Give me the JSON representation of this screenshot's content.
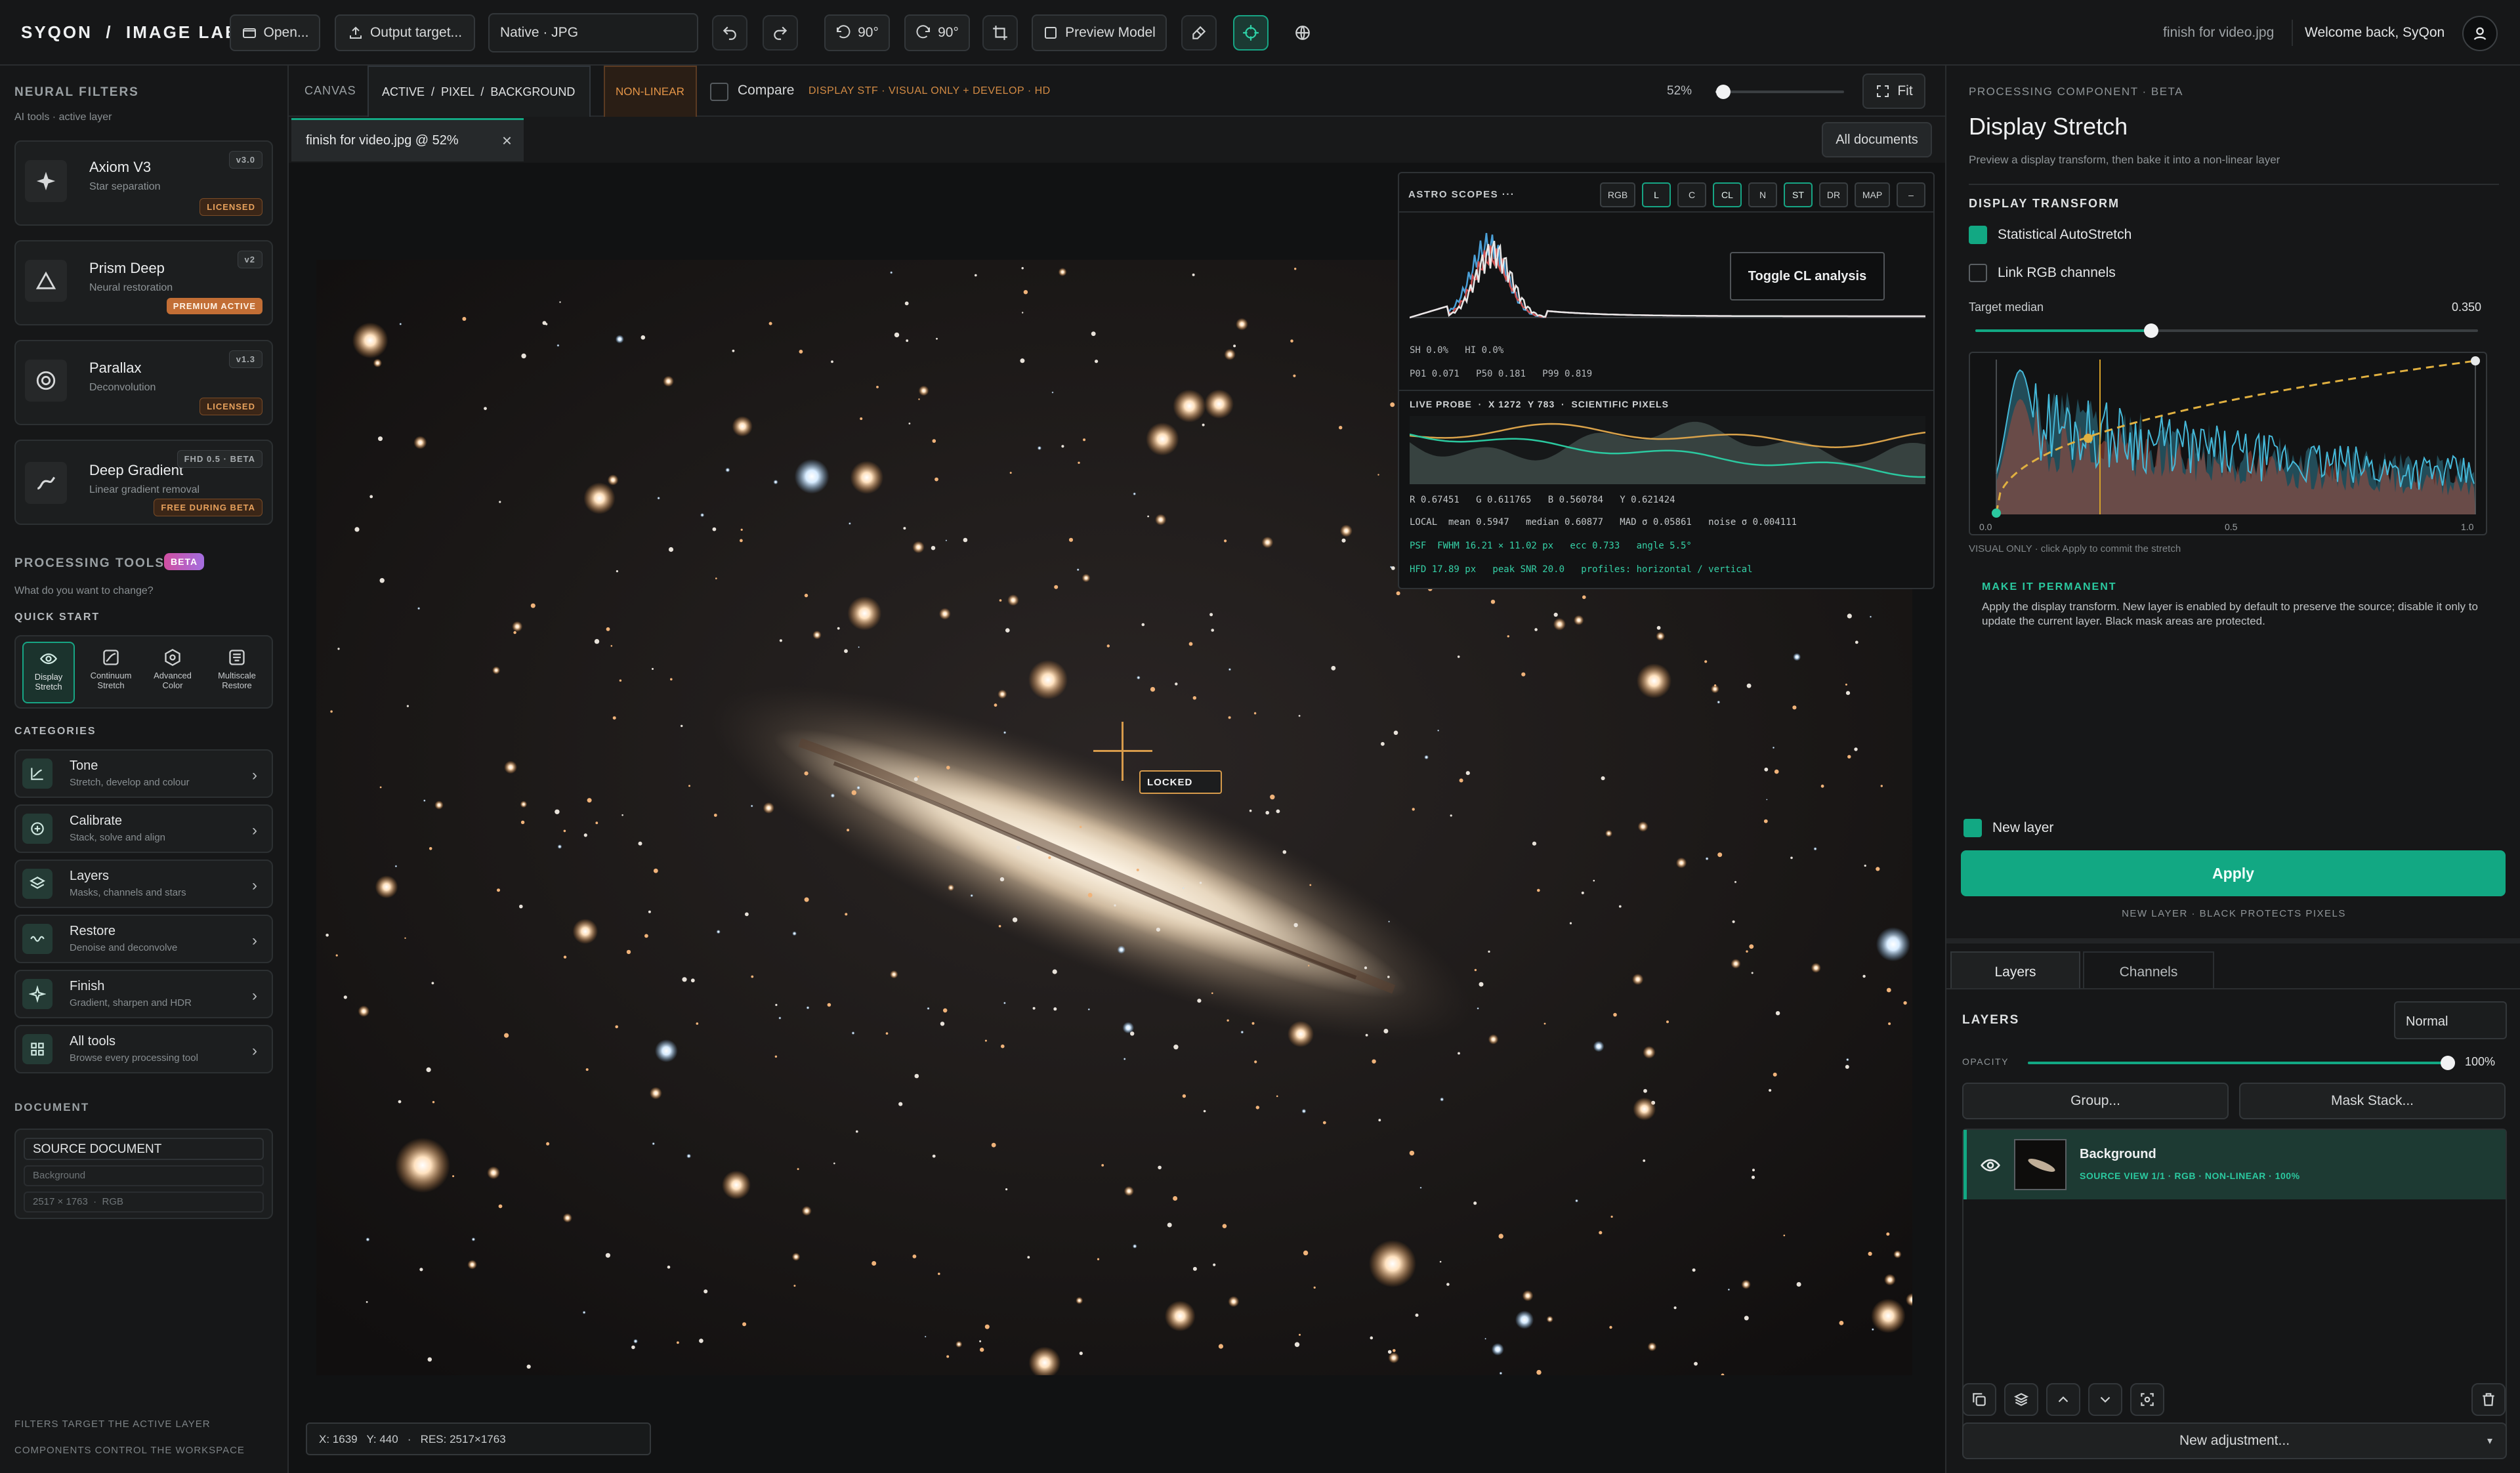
{
  "topbar": {
    "brand": "SYQON  /  IMAGE LAB",
    "open": "Open...",
    "output": "Output target...",
    "format": "Native · JPG",
    "rot_ccw": "90°",
    "rot_cw": "90°",
    "preview_model": "Preview Model",
    "filename": "finish for video.jpg",
    "welcome": "Welcome back, SyQon"
  },
  "left": {
    "neural_title": "NEURAL FILTERS",
    "neural_sub": "AI tools · active layer",
    "filters": [
      {
        "name": "Axiom V3",
        "desc": "Star separation",
        "version": "v3.0",
        "badge": "LICENSED",
        "icon": "sparkle-icon"
      },
      {
        "name": "Prism Deep",
        "desc": "Neural restoration",
        "version": "v2",
        "badge": "PREMIUM ACTIVE",
        "icon": "triangle-icon"
      },
      {
        "name": "Parallax",
        "desc": "Deconvolution",
        "version": "v1.3",
        "badge": "LICENSED",
        "icon": "target-icon"
      },
      {
        "name": "Deep Gradient",
        "desc": "Linear gradient removal",
        "version": "FHD 0.5 · BETA",
        "badge": "FREE DURING BETA",
        "icon": "wave-icon"
      }
    ],
    "processing_title": "PROCESSING TOOLS",
    "processing_badge": "BETA",
    "processing_sub": "What do you want to change?",
    "quick_start": "QUICK START",
    "quick": [
      {
        "l1": "Display",
        "l2": "Stretch"
      },
      {
        "l1": "Continuum",
        "l2": "Stretch"
      },
      {
        "l1": "Advanced",
        "l2": "Color"
      },
      {
        "l1": "Multiscale",
        "l2": "Restore"
      }
    ],
    "categories_title": "CATEGORIES",
    "categories": [
      {
        "name": "Tone",
        "desc": "Stretch, develop and colour"
      },
      {
        "name": "Calibrate",
        "desc": "Stack, solve and align"
      },
      {
        "name": "Layers",
        "desc": "Masks, channels and stars"
      },
      {
        "name": "Restore",
        "desc": "Denoise and deconvolve"
      },
      {
        "name": "Finish",
        "desc": "Gradient, sharpen and HDR"
      },
      {
        "name": "All tools",
        "desc": "Browse every processing tool"
      }
    ],
    "document_title": "DOCUMENT",
    "doc_name": "SOURCE DOCUMENT",
    "doc_layer": "Background",
    "doc_dims": "2517 × 1763  ·  RGB",
    "footer1": "FILTERS TARGET THE ACTIVE LAYER",
    "footer2": "COMPONENTS CONTROL THE WORKSPACE"
  },
  "canvas": {
    "label": "CANVAS",
    "path": "ACTIVE  /  PIXEL  /  BACKGROUND",
    "mode": "NON-LINEAR",
    "compare": "Compare",
    "display_note": "DISPLAY STF · VISUAL ONLY + DEVELOP · HD",
    "zoom": "52%",
    "zoom_fraction": 0.06,
    "fit": "Fit",
    "tab": "finish for video.jpg @ 52%",
    "all_docs": "All documents",
    "locked": "LOCKED",
    "status": "X: 1639   Y: 440   ·   RES: 2517×1763"
  },
  "scopes": {
    "title": "ASTRO SCOPES  ···",
    "buttons": [
      "RGB",
      "L",
      "C",
      "CL",
      "N",
      "ST",
      "DR",
      "MAP",
      "–"
    ],
    "tooltip": "Toggle CL analysis",
    "sh_hi": "SH 0.0%   HI 0.0%",
    "percentiles": "P01 0.071   P50 0.181   P99 0.819",
    "probe": "LIVE PROBE  ·  X 1272  Y 783  ·  SCIENTIFIC PIXELS",
    "rgb": "R 0.67451   G 0.611765   B 0.560784   Y 0.621424",
    "local": "LOCAL  mean 0.5947   median 0.60877   MAD σ 0.05861   noise σ 0.004111",
    "psf": "PSF  FWHM 16.21 × 11.02 px   ecc 0.733   angle 5.5°",
    "hfd": "HFD 17.89 px   peak SNR 20.0   profiles: horizontal / vertical"
  },
  "right": {
    "component_label": "PROCESSING COMPONENT · BETA",
    "title": "Display Stretch",
    "subtitle": "Preview a display transform, then bake it into a non-linear layer",
    "transform_title": "DISPLAY TRANSFORM",
    "auto_stretch": "Statistical AutoStretch",
    "link_rgb": "Link RGB channels",
    "target_median_label": "Target median",
    "target_median": "0.350",
    "curve_ticks": [
      "0.0",
      "0.5",
      "1.0"
    ],
    "visual_note": "VISUAL ONLY · click Apply to commit the stretch",
    "permanent_title": "MAKE IT PERMANENT",
    "permanent_text": "Apply the display transform. New layer is enabled by default to preserve the source; disable it only to update the current layer. Black mask areas are protected.",
    "new_layer": "New layer",
    "apply": "Apply",
    "apply_note": "NEW LAYER · BLACK PROTECTS PIXELS",
    "tab_layers": "Layers",
    "tab_channels": "Channels",
    "layers_title": "LAYERS",
    "blend": "Normal",
    "opacity_label": "OPACITY",
    "opacity": "100%",
    "group": "Group...",
    "mask_stack": "Mask Stack...",
    "layer_name": "Background",
    "layer_info": "SOURCE VIEW 1/1 · RGB · NON-LINEAR · 100%",
    "new_adjustment": "New adjustment..."
  },
  "colors": {
    "accent": "#12a883",
    "orange": "#d98a3a",
    "panel": "#1a1c1d"
  }
}
